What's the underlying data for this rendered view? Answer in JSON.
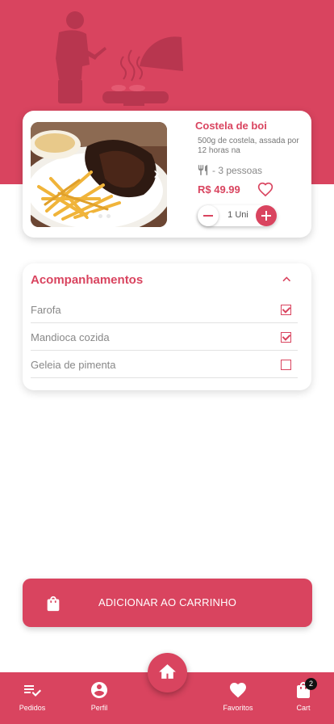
{
  "product": {
    "name": "Costela de boi",
    "description": "500g de costela, assada por 12 horas na",
    "serves": "- 3 pessoas",
    "price": "R$ 49.99",
    "quantity": "1 Uni",
    "carousel_total": 3,
    "carousel_active": 1
  },
  "accompaniments": {
    "title": "Acompanhamentos",
    "items": [
      {
        "label": "Farofa",
        "checked": true
      },
      {
        "label": "Mandioca cozida",
        "checked": true
      },
      {
        "label": "Geleia de pimenta",
        "checked": false
      }
    ]
  },
  "add_to_cart": {
    "label": "ADICIONAR AO CARRINHO"
  },
  "nav": {
    "pedidos": "Pedidos",
    "perfil": "Perfil",
    "favoritos": "Favoritos",
    "cart": "Cart",
    "cart_badge": "2"
  },
  "colors": {
    "accent": "#d9445f",
    "header_illustration": "#b8364f"
  },
  "icons": {
    "header": "barbecue-illustration",
    "serves": "cutlery-icon",
    "favorite": "heart-outline-icon",
    "add_to_cart": "shopping-bag-icon",
    "pedidos": "playlist-check-icon",
    "perfil": "account-circle-icon",
    "favoritos": "heart-icon",
    "cart": "shopping-bag-icon",
    "home": "home-icon"
  }
}
